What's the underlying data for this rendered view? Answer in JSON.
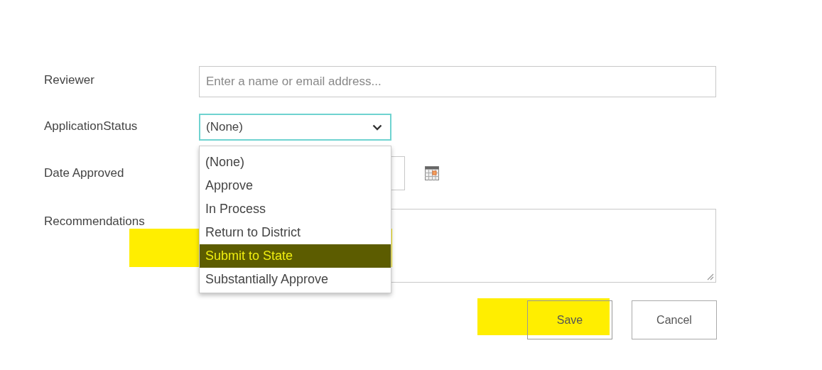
{
  "fields": [
    {
      "kind": "people",
      "label": "Reviewer",
      "placeholder": "Enter a name or email address..."
    },
    {
      "kind": "select",
      "label": "ApplicationStatus",
      "value": "(None)",
      "open": true,
      "options": [
        {
          "label": "(None)",
          "highlighted": false
        },
        {
          "label": "Approve",
          "highlighted": false
        },
        {
          "label": "In Process",
          "highlighted": false
        },
        {
          "label": "Return to District",
          "highlighted": false
        },
        {
          "label": "Submit to State",
          "highlighted": true
        },
        {
          "label": "Substantially Approve",
          "highlighted": false
        }
      ]
    },
    {
      "kind": "date",
      "label": "Date Approved"
    },
    {
      "kind": "multiline",
      "label": "Recommendations"
    }
  ],
  "buttons": [
    {
      "label": "Save",
      "kind": "primary"
    },
    {
      "label": "Cancel",
      "kind": "secondary"
    }
  ],
  "annotations": [
    {
      "kind": "highlighter"
    },
    {
      "kind": "highlighter"
    }
  ]
}
